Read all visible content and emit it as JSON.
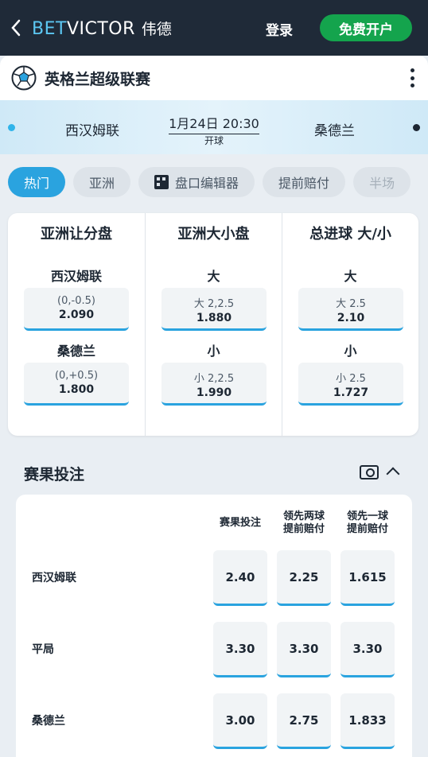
{
  "header": {
    "back_icon": "chevron-left-icon",
    "logo_bet": "BET",
    "logo_victor": "VICTOR",
    "logo_cn": "伟德",
    "login_label": "登录",
    "signup_label": "免费开户",
    "colors": {
      "bar": "#1f2a38",
      "signup": "#14a44d",
      "brand": "#5cc7f2"
    }
  },
  "league": {
    "name": "英格兰超级联赛",
    "icon": "football-icon",
    "menu_icon": "kebab-icon"
  },
  "match": {
    "home": "西汉姆联",
    "away": "桑德兰",
    "datetime": "1月24日 20:30",
    "status": "开球"
  },
  "tabs": [
    {
      "label": "热门",
      "active": true
    },
    {
      "label": "亚洲"
    },
    {
      "label": "盘口编辑器",
      "icon": "grid-icon"
    },
    {
      "label": "提前赔付"
    },
    {
      "label": "半场"
    }
  ],
  "markets": [
    {
      "title": "亚洲让分盘",
      "rows": [
        {
          "label": "西汉姆联",
          "line": "(0,-0.5)",
          "price": "2.090"
        },
        {
          "label": "桑德兰",
          "line": "(0,+0.5)",
          "price": "1.800"
        }
      ]
    },
    {
      "title": "亚洲大小盘",
      "rows": [
        {
          "label": "大",
          "line": "大 2,2.5",
          "price": "1.880"
        },
        {
          "label": "小",
          "line": "小 2,2.5",
          "price": "1.990"
        }
      ]
    },
    {
      "title": "总进球 大/小",
      "rows": [
        {
          "label": "大",
          "line": "大 2.5",
          "price": "2.10"
        },
        {
          "label": "小",
          "line": "小 2.5",
          "price": "1.727"
        }
      ]
    }
  ],
  "result_section": {
    "title": "赛果投注",
    "cash_icon": "cash-out-icon",
    "collapse_icon": "chevron-up-icon",
    "columns": [
      "赛果投注",
      "领先两球\n提前赔付",
      "领先一球\n提前赔付"
    ],
    "col1": "赛果投注",
    "col2a": "领先两球",
    "col2b": "提前赔付",
    "col3a": "领先一球",
    "col3b": "提前赔付",
    "rows": [
      {
        "label": "西汉姆联",
        "prices": [
          "2.40",
          "2.25",
          "1.615"
        ]
      },
      {
        "label": "平局",
        "prices": [
          "3.30",
          "3.30",
          "3.30"
        ]
      },
      {
        "label": "桑德兰",
        "prices": [
          "3.00",
          "2.75",
          "1.833"
        ]
      }
    ]
  }
}
